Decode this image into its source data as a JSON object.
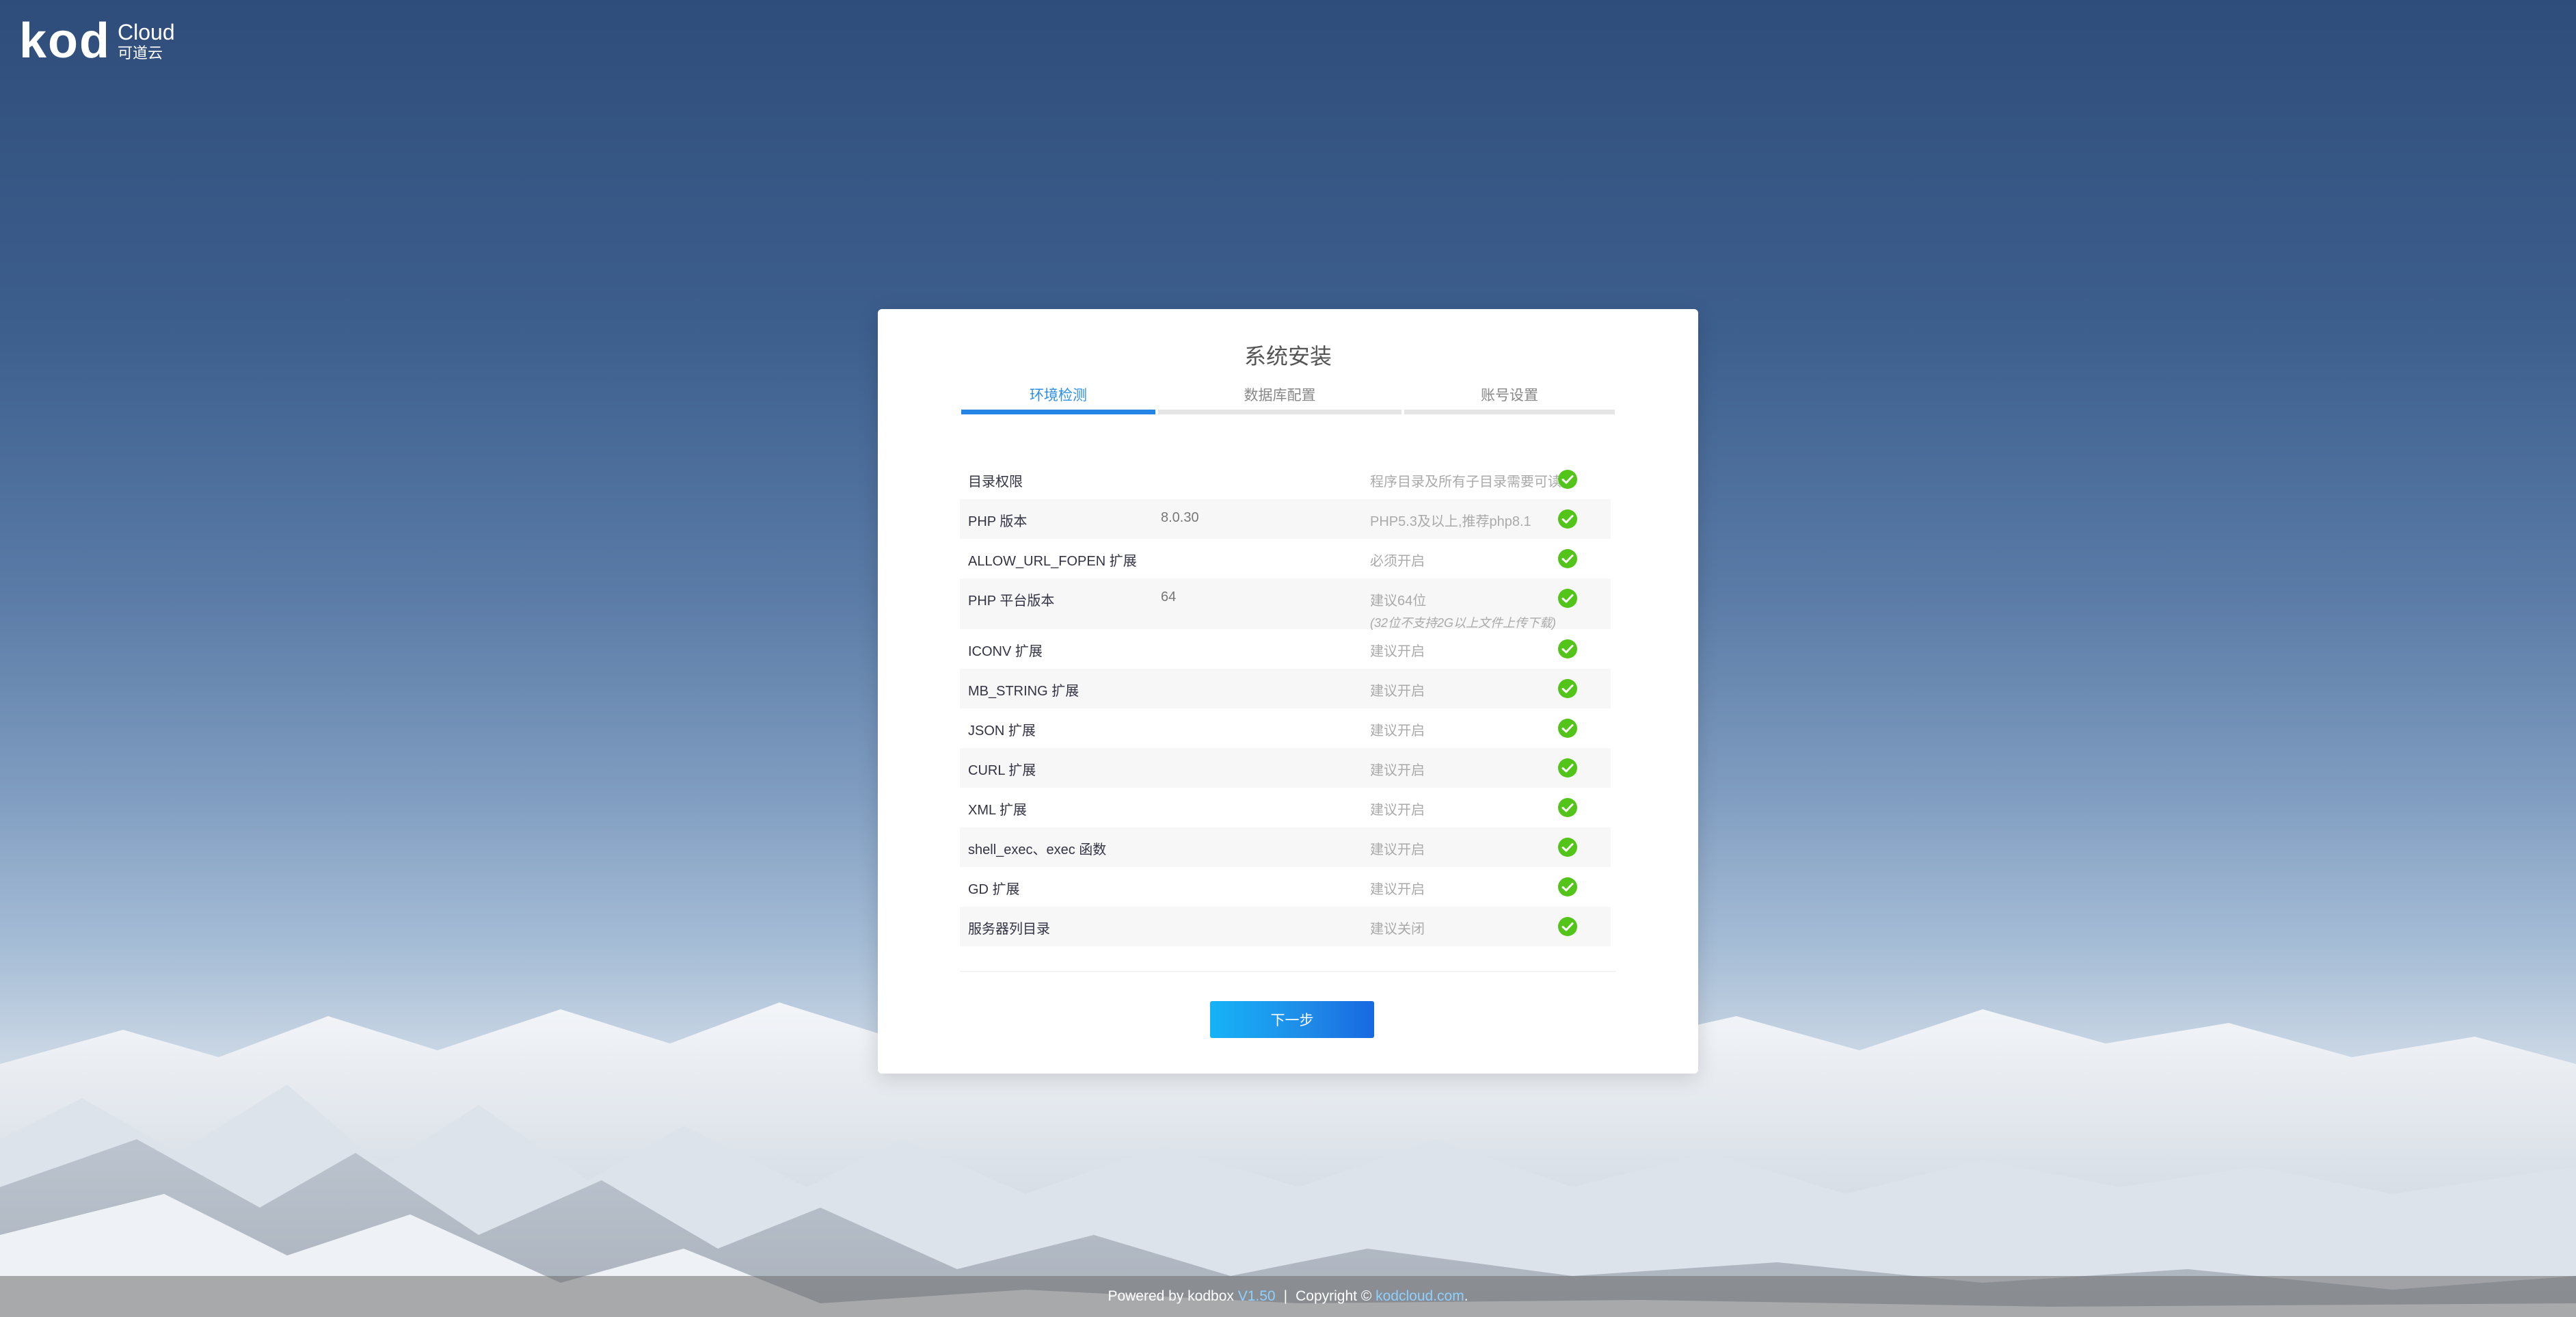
{
  "logo": {
    "mark": "kod",
    "cloud": "Cloud",
    "cn": "可道云"
  },
  "panel": {
    "title": "系统安装",
    "tabs": [
      {
        "label": "环境检测",
        "active": true
      },
      {
        "label": "数据库配置",
        "active": false
      },
      {
        "label": "账号设置",
        "active": false
      }
    ],
    "checks": [
      {
        "name": "目录权限",
        "value": "",
        "requirement": "程序目录及所有子目录需要可读写",
        "note": "",
        "status": "ok"
      },
      {
        "name": "PHP 版本",
        "value": "8.0.30",
        "requirement": "PHP5.3及以上,推荐php8.1",
        "note": "",
        "status": "ok"
      },
      {
        "name": "ALLOW_URL_FOPEN 扩展",
        "value": "",
        "requirement": "必须开启",
        "note": "",
        "status": "ok"
      },
      {
        "name": "PHP 平台版本",
        "value": "64",
        "requirement": "建议64位",
        "note": "(32位不支持2G以上文件上传下载)",
        "status": "ok"
      },
      {
        "name": "ICONV 扩展",
        "value": "",
        "requirement": "建议开启",
        "note": "",
        "status": "ok"
      },
      {
        "name": "MB_STRING 扩展",
        "value": "",
        "requirement": "建议开启",
        "note": "",
        "status": "ok"
      },
      {
        "name": "JSON 扩展",
        "value": "",
        "requirement": "建议开启",
        "note": "",
        "status": "ok"
      },
      {
        "name": "CURL 扩展",
        "value": "",
        "requirement": "建议开启",
        "note": "",
        "status": "ok"
      },
      {
        "name": "XML 扩展",
        "value": "",
        "requirement": "建议开启",
        "note": "",
        "status": "ok"
      },
      {
        "name": "shell_exec、exec 函数",
        "value": "",
        "requirement": "建议开启",
        "note": "",
        "status": "ok"
      },
      {
        "name": "GD 扩展",
        "value": "",
        "requirement": "建议开启",
        "note": "",
        "status": "ok"
      },
      {
        "name": "服务器列目录",
        "value": "",
        "requirement": "建议关闭",
        "note": "",
        "status": "ok"
      }
    ],
    "next_label": "下一步"
  },
  "footer": {
    "powered_by": "Powered by kodbox",
    "version": "V1.50",
    "separator": "|",
    "copyright": "Copyright ©",
    "site": "kodcloud.com",
    "end": "."
  },
  "colors": {
    "accent": "#2485e6",
    "ok": "#52c41a"
  }
}
